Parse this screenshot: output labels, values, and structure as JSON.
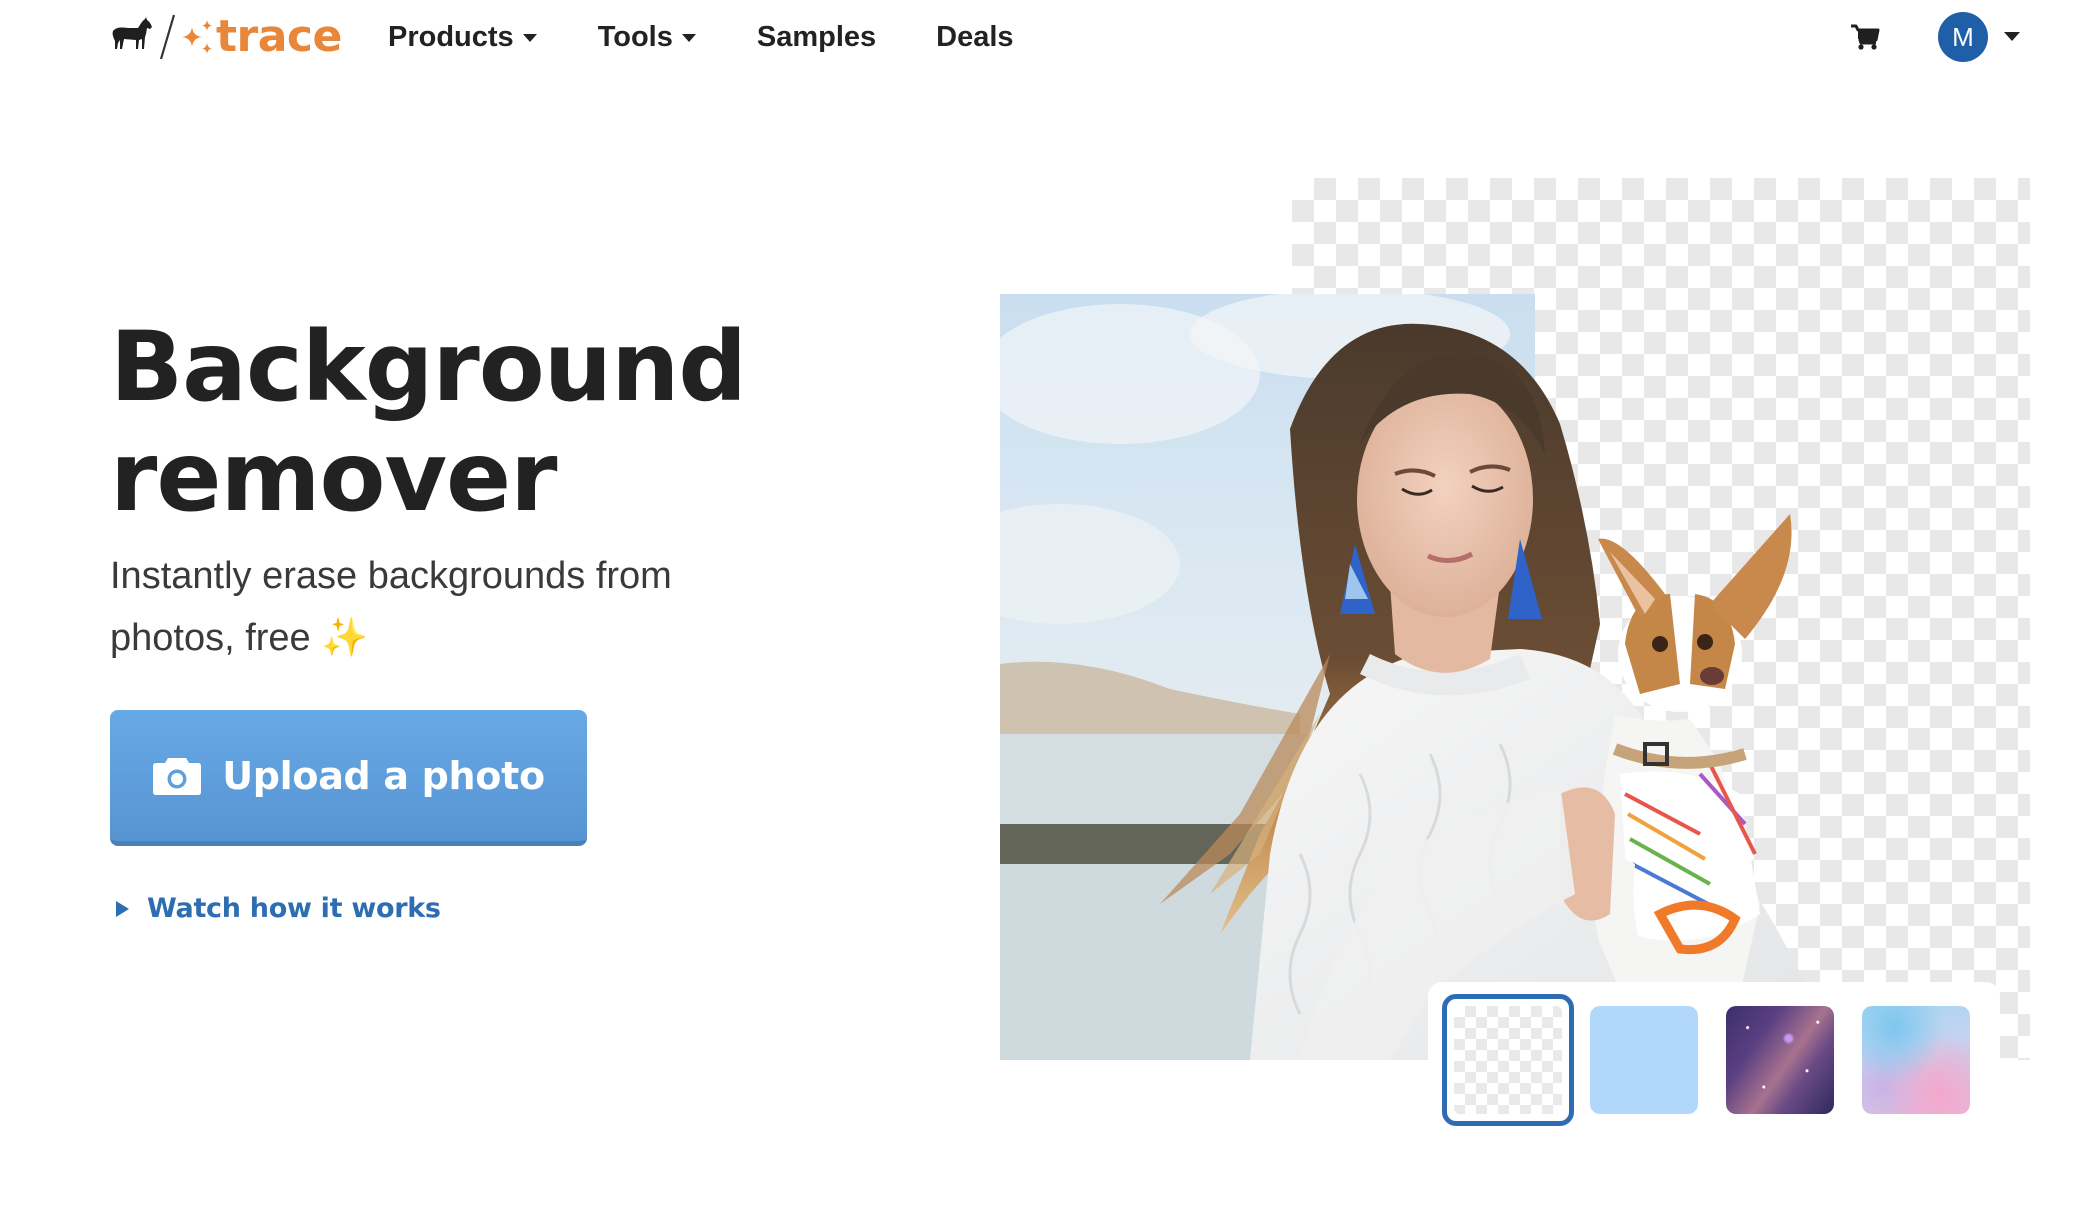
{
  "header": {
    "logo": {
      "brand_text": "trace",
      "brand_color": "#E8873A",
      "icons": [
        "horse-icon",
        "slash-divider",
        "sparkle-icon"
      ]
    },
    "nav": [
      {
        "label": "Products",
        "has_dropdown": true
      },
      {
        "label": "Tools",
        "has_dropdown": true
      },
      {
        "label": "Samples",
        "has_dropdown": false
      },
      {
        "label": "Deals",
        "has_dropdown": false
      }
    ],
    "cart_icon": "cart-icon",
    "avatar": {
      "initial": "M",
      "color": "#1F5FA8",
      "has_dropdown": true
    }
  },
  "hero": {
    "title_line1": "Background",
    "title_line2": "remover",
    "subtitle_line1": "Instantly erase backgrounds from",
    "subtitle_line2": "photos, free",
    "subtitle_emoji": "✨",
    "upload_button": {
      "label": "Upload a photo",
      "icon": "camera-icon",
      "color": "#5E9FDD"
    },
    "watch_link": {
      "label": "Watch how it works",
      "icon": "play-triangle-icon",
      "color": "#2D6DB2"
    }
  },
  "demo": {
    "description": "Woman holding a chihuahua; right half of photo shows background removed (transparent checkerboard)",
    "background_options": [
      {
        "name": "transparent",
        "selected": true
      },
      {
        "name": "light-blue",
        "color": "#B1D7FA",
        "selected": false
      },
      {
        "name": "galaxy",
        "selected": false
      },
      {
        "name": "pastel-marble",
        "selected": false
      }
    ],
    "selected_border_color": "#2E6DB4"
  }
}
